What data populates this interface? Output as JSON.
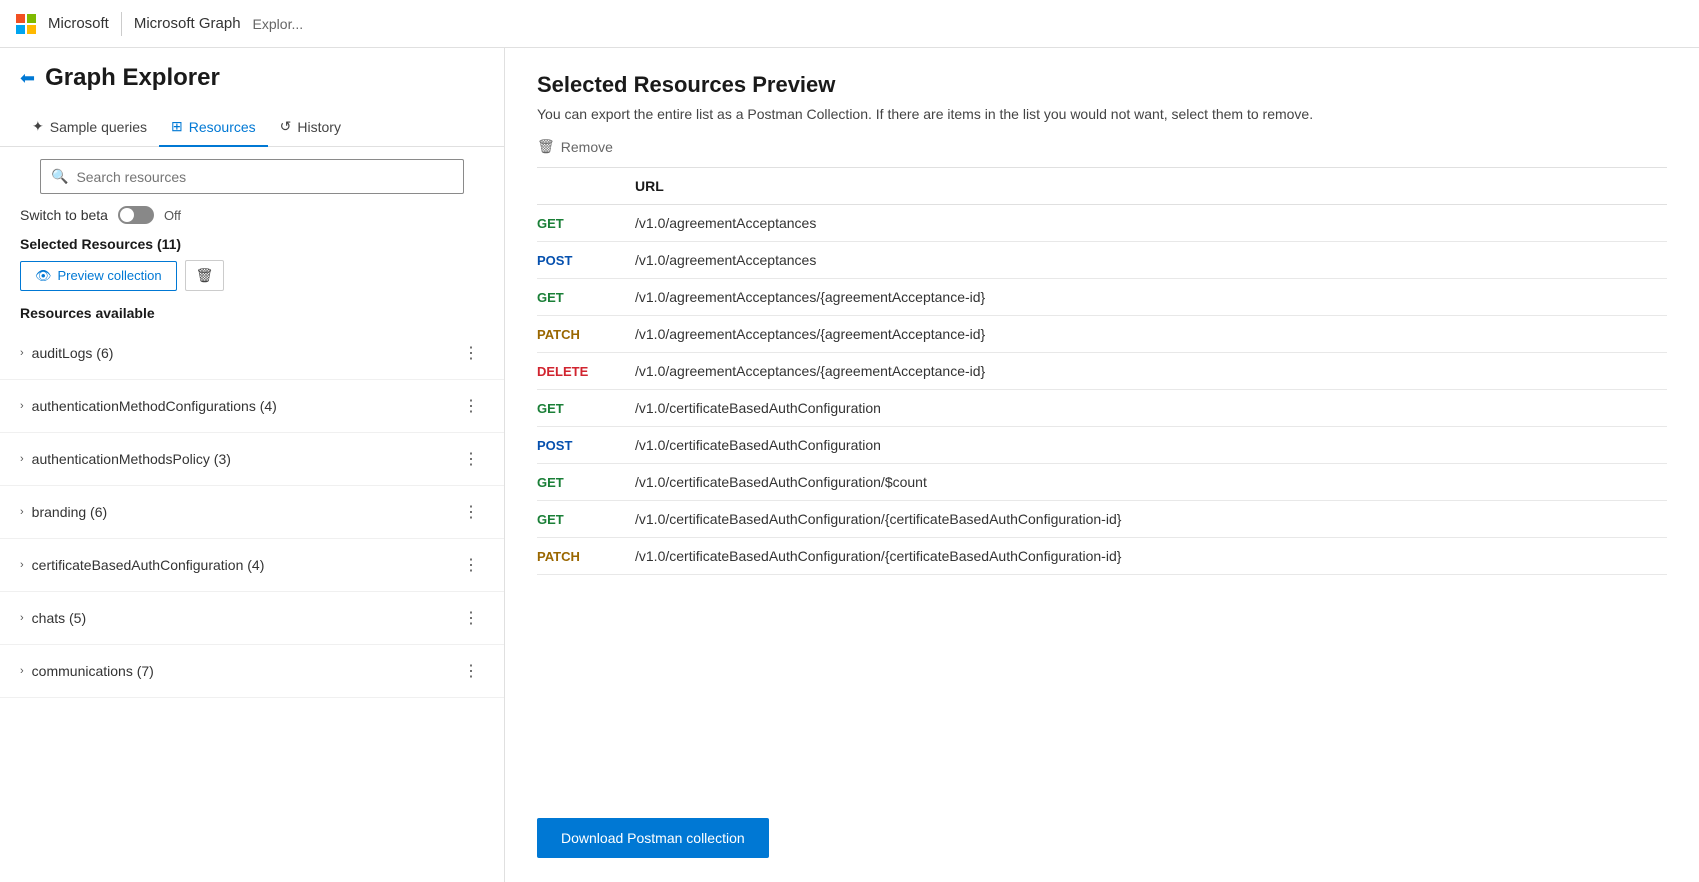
{
  "topbar": {
    "microsoft_label": "Microsoft",
    "product_label": "Microsoft Graph",
    "page_label": "Explor..."
  },
  "sidebar": {
    "app_icon": "←",
    "app_title": "Graph Explorer",
    "tabs": [
      {
        "id": "sample-queries",
        "label": "Sample queries",
        "icon": "✦",
        "active": false
      },
      {
        "id": "resources",
        "label": "Resources",
        "icon": "⊞",
        "active": true
      },
      {
        "id": "history",
        "label": "History",
        "icon": "↺",
        "active": false
      }
    ],
    "search_placeholder": "Search resources",
    "beta_label": "Switch to beta",
    "beta_off_label": "Off",
    "selected_resources_header": "Selected Resources (11)",
    "preview_btn_label": "Preview collection",
    "resources_available_header": "Resources available",
    "resources": [
      {
        "name": "auditLogs (6)"
      },
      {
        "name": "authenticationMethodConfigurations (4)"
      },
      {
        "name": "authenticationMethodsPolicy (3)"
      },
      {
        "name": "branding (6)"
      },
      {
        "name": "certificateBasedAuthConfiguration (4)"
      },
      {
        "name": "chats (5)"
      },
      {
        "name": "communications (7)"
      }
    ]
  },
  "right_panel": {
    "title": "Selected Resources Preview",
    "subtitle": "You can export the entire list as a Postman Collection. If there are items in the list you would not want, select them to remove.",
    "remove_label": "Remove",
    "col_url": "URL",
    "rows": [
      {
        "method": "GET",
        "url": "/v1.0/agreementAcceptances"
      },
      {
        "method": "POST",
        "url": "/v1.0/agreementAcceptances"
      },
      {
        "method": "GET",
        "url": "/v1.0/agreementAcceptances/{agreementAcceptance-id}"
      },
      {
        "method": "PATCH",
        "url": "/v1.0/agreementAcceptances/{agreementAcceptance-id}"
      },
      {
        "method": "DELETE",
        "url": "/v1.0/agreementAcceptances/{agreementAcceptance-id}"
      },
      {
        "method": "GET",
        "url": "/v1.0/certificateBasedAuthConfiguration"
      },
      {
        "method": "POST",
        "url": "/v1.0/certificateBasedAuthConfiguration"
      },
      {
        "method": "GET",
        "url": "/v1.0/certificateBasedAuthConfiguration/$count"
      },
      {
        "method": "GET",
        "url": "/v1.0/certificateBasedAuthConfiguration/{certificateBasedAuthConfiguration-id}"
      },
      {
        "method": "PATCH",
        "url": "/v1.0/certificateBasedAuthConfiguration/{certificateBasedAuthConfiguration-id}"
      }
    ],
    "download_btn_label": "Download Postman collection"
  }
}
